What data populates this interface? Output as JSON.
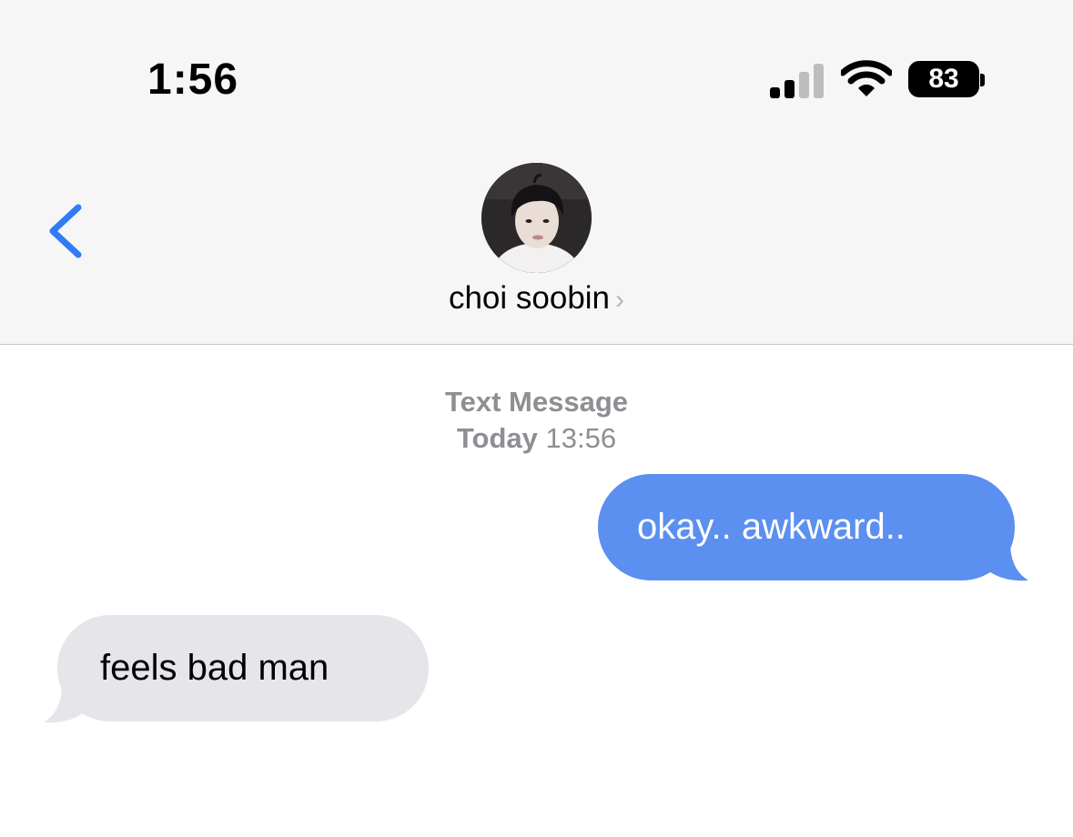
{
  "status_bar": {
    "time": "1:56",
    "battery": "83",
    "icons": [
      "signal-icon",
      "wifi-icon",
      "battery-icon"
    ]
  },
  "header": {
    "back_icon": "chevron-left-icon",
    "contact_name": "choi soobin",
    "contact_chevron": "›"
  },
  "conversation": {
    "service_label": "Text Message",
    "date_label": "Today",
    "time_label": "13:56",
    "messages": [
      {
        "direction": "sent",
        "text": "okay.. awkward.."
      },
      {
        "direction": "received",
        "text": "feels bad man"
      }
    ]
  },
  "colors": {
    "sent_bubble": "#5b8ff0",
    "received_bubble": "#e5e5ea",
    "accent": "#2f7cf6"
  }
}
